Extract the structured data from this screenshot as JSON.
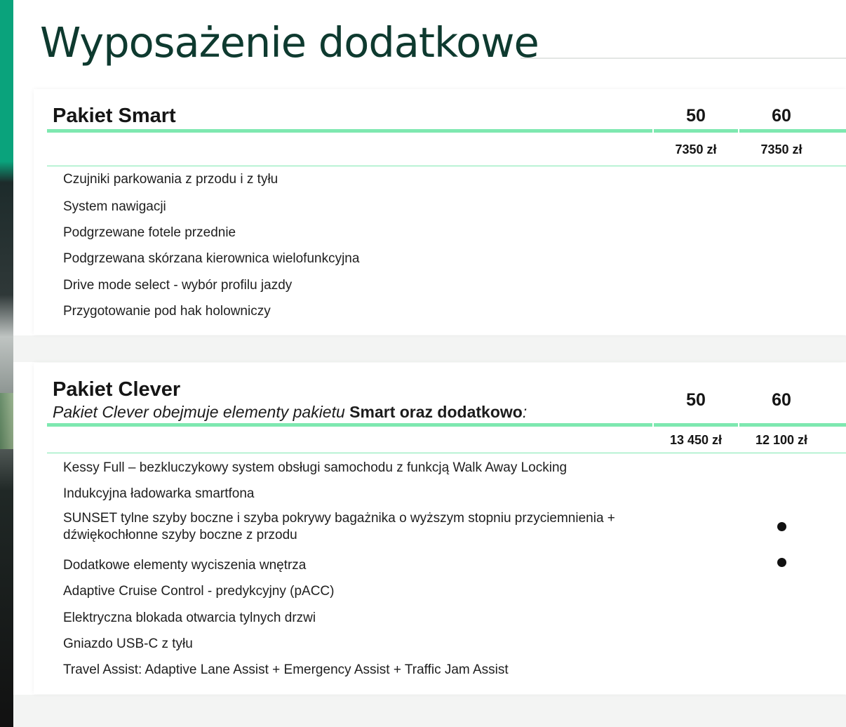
{
  "page": {
    "title": "Wyposażenie dodatkowe"
  },
  "smart": {
    "name": "Pakiet Smart",
    "columns": [
      "50",
      "60"
    ],
    "prices": [
      "7350 zł",
      "7350 zł"
    ],
    "items": [
      "Czujniki parkowania z przodu i z tyłu",
      "System nawigacji",
      "Podgrzewane fotele przednie",
      "Podgrzewana skórzana kierownica wielofunkcyjna",
      "Drive mode select - wybór profilu jazdy",
      "Przygotowanie pod hak holowniczy"
    ]
  },
  "clever": {
    "name": "Pakiet Clever",
    "subtitle_prefix": "Pakiet Clever obejmuje elementy pakietu ",
    "subtitle_bold": "Smart oraz dodatkowo",
    "subtitle_suffix": ":",
    "columns": [
      "50",
      "60"
    ],
    "prices": [
      "13 450 zł",
      "12 100 zł"
    ],
    "items": [
      "Kessy Full – bezkluczykowy system obsługi samochodu z funkcją Walk Away Locking",
      "Indukcyjna ładowarka smartfona",
      "SUNSET tylne szyby boczne i szyba pokrywy bagażnika o wyższym stopniu przyciemnienia +",
      "dźwiękochłonne szyby boczne z przodu",
      "Dodatkowe elementy wyciszenia wnętrza",
      "Adaptive Cruise Control - predykcyjny (pACC)",
      "Elektryczna blokada otwarcia tylnych drzwi",
      "Gniazdo USB-C z tyłu",
      "Travel Assist: Adaptive Lane Assist + Emergency Assist + Traffic Jam Assist"
    ],
    "marks": {
      "sunset_60": true,
      "wyciszenie_60": true
    }
  },
  "colors": {
    "accent_green": "#7ee8b0",
    "title_color": "#0e3a2f",
    "side_green": "#0aa37c"
  }
}
